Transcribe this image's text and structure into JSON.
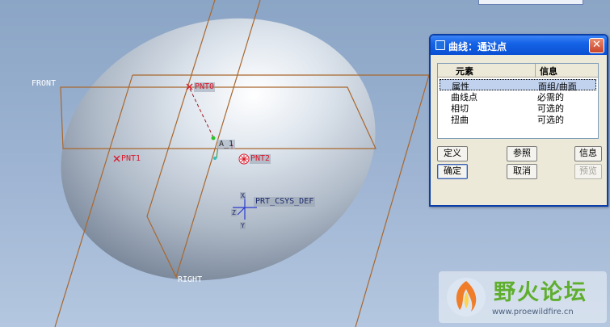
{
  "viewport": {
    "labels": {
      "front": "FRONT",
      "right": "RIGHT",
      "pnt0": "PNT0",
      "pnt1": "PNT1",
      "pnt2": "PNT2",
      "csys": "PRT_CSYS_DEF",
      "axis_marker": "A_1",
      "csys_x": "X",
      "csys_y": "Y",
      "csys_z": "Z"
    }
  },
  "dialog": {
    "title": "曲线：通过点",
    "close_label": "✕",
    "columns": {
      "element": "元素",
      "info": "信息"
    },
    "rows": [
      {
        "element": "属性",
        "info": "面组/曲面",
        "selected": true
      },
      {
        "element": "曲线点",
        "info": "必需的"
      },
      {
        "element": "相切",
        "info": "可选的"
      },
      {
        "element": "扭曲",
        "info": "可选的"
      }
    ],
    "buttons": {
      "define": "定义",
      "reference": "参照",
      "info": "信息",
      "ok": "确定",
      "cancel": "取消",
      "preview": "预览"
    }
  },
  "watermark": {
    "title": "野火论坛",
    "url": "www.proewildfire.cn"
  },
  "colors": {
    "plane_lines": "#a9672d",
    "point_red": "#d8182b",
    "titlebar_blue": "#0b4fd3"
  }
}
